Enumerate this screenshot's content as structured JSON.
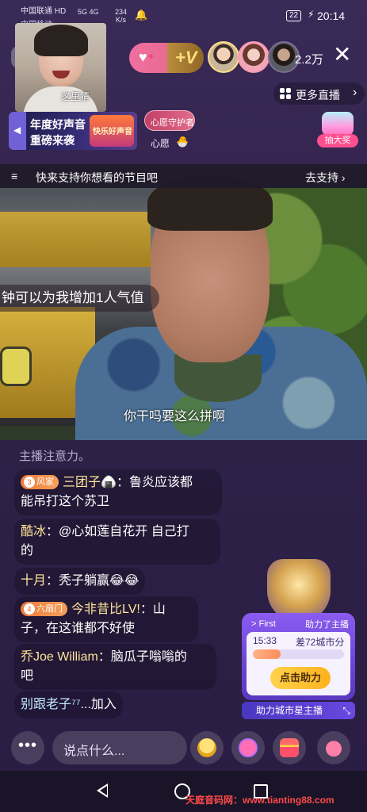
{
  "status_bar": {
    "carrier": "中国联通",
    "carrier_hd": "HD",
    "carrier2": "中国移动",
    "signal": "5G  4G",
    "speed_value": "234",
    "speed_unit": "K/s",
    "battery": "22",
    "time": "20:14"
  },
  "pip": {
    "caption": "这里猜"
  },
  "viewers": {
    "count": "2.2万"
  },
  "more_live": {
    "label": "更多直播",
    "chevron": "›"
  },
  "banner": {
    "line1": "年度好声音",
    "line2": "重磅来袭",
    "badge": "快乐好声音"
  },
  "guard": {
    "pill": "心愿守护者",
    "sub": "心愿",
    "sub_icon": "🐣"
  },
  "lottery": {
    "label": "抽大奖"
  },
  "video": {
    "strip_icon": "≡",
    "strip_msg": "快来支持你想看的节目吧",
    "strip_go": "去支持 ›",
    "boost": "钟可以为我增加1人气值",
    "subtitle": "你干吗要这么拼啊"
  },
  "chat": {
    "notice": "主播注意力。",
    "messages": [
      {
        "tag_num": "3",
        "tag": "风家",
        "name": "三团子🍙",
        "sep": "：",
        "text": "鲁炎应该都",
        "text2": "能吊打这个苏卫"
      },
      {
        "name": "酷冰",
        "sep": "：",
        "text": "@心如莲自花开 自己打",
        "text2": "的"
      },
      {
        "name": "十月",
        "sep": "：",
        "text": "秃子躺赢😂😂"
      },
      {
        "tag_num": "4",
        "tag": "六扇门",
        "name": "今非昔比LV!",
        "sep": "：",
        "text": "山",
        "text2": "子，在这谁都不好使"
      },
      {
        "name": "乔Joe William",
        "sep": "：",
        "text": "脑瓜子嗡嗡的",
        "text2": "吧"
      },
      {
        "name": "别跟老子⁷⁷",
        "text": "...加入"
      }
    ]
  },
  "promo": {
    "first": "> First",
    "helped": "助力了主播",
    "time": "15:33",
    "diff": "差72城市分",
    "progress": 0.3,
    "cta": "点击助力",
    "footer": "助力城市星主播",
    "expand": "⤡"
  },
  "bottom": {
    "more": "•••",
    "placeholder": "说点什么..."
  },
  "nav": {
    "watermark": "天庭音码网：www.tianting88.com"
  },
  "colors": {
    "accent": "#ffe59a",
    "brand_purple": "#6a44d6",
    "cta": "#ffc832"
  }
}
